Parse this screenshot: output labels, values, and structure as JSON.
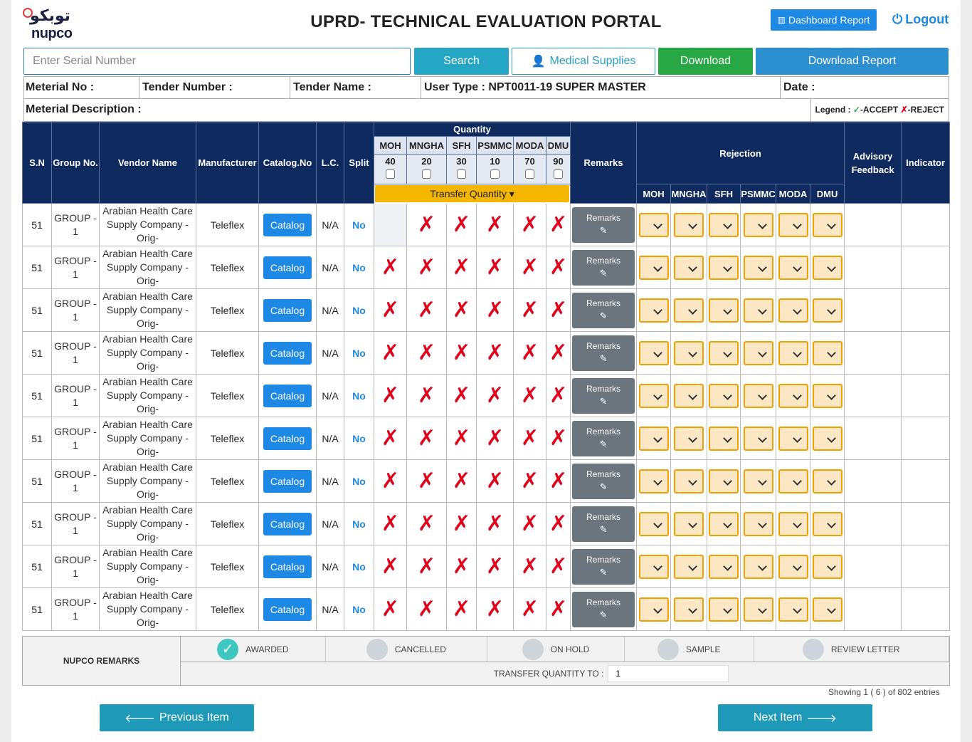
{
  "header": {
    "logo_ar": "توبكو",
    "logo_en": "nupco",
    "title": "UPRD- TECHNICAL EVALUATION PORTAL",
    "dashboard_report": "Dashboard Report",
    "logout": "Logout"
  },
  "toolbar": {
    "serial_placeholder": "Enter Serial Number",
    "search": "Search",
    "medical_supplies": "Medical Supplies",
    "download": "Download",
    "download_report": "Download Report"
  },
  "info": {
    "material_no": "Meterial No :",
    "tender_number": "Tender Number :",
    "tender_name": "Tender Name :",
    "user_type": "User Type : NPT0011-19 SUPER MASTER",
    "date": "Date :",
    "material_description": "Meterial Description :",
    "legend_label": "Legend :",
    "legend_accept": "-ACCEPT",
    "legend_reject": "-REJECT"
  },
  "table": {
    "headers": {
      "sn": "S.N",
      "group": "Group No.",
      "vendor": "Vendor Name",
      "manufacturer": "Manufacturer",
      "catalog": "Catalog.No",
      "lc": "L.C.",
      "split": "Split",
      "quantity": "Quantity",
      "remarks": "Remarks",
      "rejection": "Rejection",
      "advisory": "Advisory Feedback",
      "indicator": "Indicator",
      "transfer_quantity": "Transfer Quantity"
    },
    "regions": [
      "MOH",
      "MNGHA",
      "SFH",
      "PSMMC",
      "MODA",
      "DMU"
    ],
    "quantities": [
      "40",
      "20",
      "30",
      "10",
      "70",
      "90"
    ],
    "rows": [
      {
        "sn": "51",
        "group": "GROUP - 1",
        "vendor": "Arabian Health Care Supply Company - Orig-",
        "manufacturer": "Teleflex",
        "catalog": "Catalog",
        "lc": "N/A",
        "split": "No",
        "remarks": "Remarks",
        "marks": [
          "",
          "✗",
          "✗",
          "✗",
          "✗",
          "✗"
        ]
      },
      {
        "sn": "51",
        "group": "GROUP - 1",
        "vendor": "Arabian Health Care Supply Company - Orig-",
        "manufacturer": "Teleflex",
        "catalog": "Catalog",
        "lc": "N/A",
        "split": "No",
        "remarks": "Remarks",
        "marks": [
          "✗",
          "✗",
          "✗",
          "✗",
          "✗",
          "✗"
        ]
      },
      {
        "sn": "51",
        "group": "GROUP - 1",
        "vendor": "Arabian Health Care Supply Company - Orig-",
        "manufacturer": "Teleflex",
        "catalog": "Catalog",
        "lc": "N/A",
        "split": "No",
        "remarks": "Remarks",
        "marks": [
          "✗",
          "✗",
          "✗",
          "✗",
          "✗",
          "✗"
        ]
      },
      {
        "sn": "51",
        "group": "GROUP - 1",
        "vendor": "Arabian Health Care Supply Company - Orig-",
        "manufacturer": "Teleflex",
        "catalog": "Catalog",
        "lc": "N/A",
        "split": "No",
        "remarks": "Remarks",
        "marks": [
          "✗",
          "✗",
          "✗",
          "✗",
          "✗",
          "✗"
        ]
      },
      {
        "sn": "51",
        "group": "GROUP - 1",
        "vendor": "Arabian Health Care Supply Company - Orig-",
        "manufacturer": "Teleflex",
        "catalog": "Catalog",
        "lc": "N/A",
        "split": "No",
        "remarks": "Remarks",
        "marks": [
          "✗",
          "✗",
          "✗",
          "✗",
          "✗",
          "✗"
        ]
      },
      {
        "sn": "51",
        "group": "GROUP - 1",
        "vendor": "Arabian Health Care Supply Company - Orig-",
        "manufacturer": "Teleflex",
        "catalog": "Catalog",
        "lc": "N/A",
        "split": "No",
        "remarks": "Remarks",
        "marks": [
          "✗",
          "✗",
          "✗",
          "✗",
          "✗",
          "✗"
        ]
      },
      {
        "sn": "51",
        "group": "GROUP - 1",
        "vendor": "Arabian Health Care Supply Company - Orig-",
        "manufacturer": "Teleflex",
        "catalog": "Catalog",
        "lc": "N/A",
        "split": "No",
        "remarks": "Remarks",
        "marks": [
          "✗",
          "✗",
          "✗",
          "✗",
          "✗",
          "✗"
        ]
      },
      {
        "sn": "51",
        "group": "GROUP - 1",
        "vendor": "Arabian Health Care Supply Company - Orig-",
        "manufacturer": "Teleflex",
        "catalog": "Catalog",
        "lc": "N/A",
        "split": "No",
        "remarks": "Remarks",
        "marks": [
          "✗",
          "✗",
          "✗",
          "✗",
          "✗",
          "✗"
        ]
      },
      {
        "sn": "51",
        "group": "GROUP - 1",
        "vendor": "Arabian Health Care Supply Company - Orig-",
        "manufacturer": "Teleflex",
        "catalog": "Catalog",
        "lc": "N/A",
        "split": "No",
        "remarks": "Remarks",
        "marks": [
          "✗",
          "✗",
          "✗",
          "✗",
          "✗",
          "✗"
        ]
      },
      {
        "sn": "51",
        "group": "GROUP - 1",
        "vendor": "Arabian Health Care Supply Company - Orig-",
        "manufacturer": "Teleflex",
        "catalog": "Catalog",
        "lc": "N/A",
        "split": "No",
        "remarks": "Remarks",
        "marks": [
          "✗",
          "✗",
          "✗",
          "✗",
          "✗",
          "✗"
        ]
      }
    ]
  },
  "footer": {
    "nupco_remarks": "NUPCO REMARKS",
    "statuses": [
      {
        "label": "AWARDED",
        "selected": true
      },
      {
        "label": "CANCELLED",
        "selected": false
      },
      {
        "label": "ON HOLD",
        "selected": false
      },
      {
        "label": "SAMPLE",
        "selected": false
      },
      {
        "label": "REVIEW LETTER",
        "selected": false
      }
    ],
    "transfer_quantity_label": "TRANSFER QUANTITY TO :",
    "transfer_quantity_value": "1",
    "showing": "Showing 1 ( 6 ) of 802 entries",
    "previous": "Previous Item",
    "next": "Next Item"
  },
  "colors": {
    "primary": "#1e88e5",
    "header_bg": "#0e2a5e",
    "reject": "#e0001a",
    "accept": "#28a745",
    "transfer": "#f5b600"
  }
}
